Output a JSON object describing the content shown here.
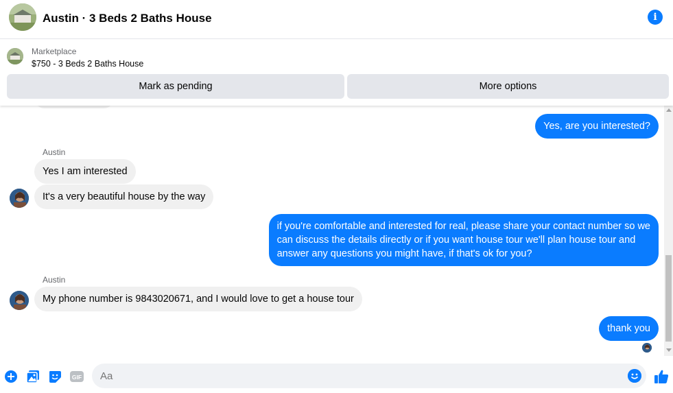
{
  "header": {
    "title": "Austin · 3 Beds 2 Baths House",
    "info_icon": "info-icon"
  },
  "listing": {
    "source": "Marketplace",
    "price_title": "$750 - 3 Beds 2 Baths House",
    "mark_pending_label": "Mark as pending",
    "more_options_label": "More options"
  },
  "messages": [
    {
      "from": "me",
      "text": "Yes, are you interested?"
    },
    {
      "from": "Austin",
      "sender_label": "Austin",
      "text": "Yes I am interested"
    },
    {
      "from": "Austin",
      "text": "It's a very beautiful house by the way"
    },
    {
      "from": "me",
      "lines": [
        "if you're comfortable and interested for real, please share your contact number so we",
        "can discuss the details directly or if you want house tour we'll plan house tour and",
        "answer any questions you might have, if that's ok for you?"
      ]
    },
    {
      "from": "Austin",
      "sender_label": "Austin",
      "text": "My phone number is 9843020671, and I would love to get a house tour"
    },
    {
      "from": "me",
      "text": "thank you"
    }
  ],
  "composer": {
    "placeholder": "Aa",
    "icons": [
      "plus-icon",
      "photo-icon",
      "sticker-icon",
      "gif-icon",
      "emoji-icon",
      "like-icon"
    ],
    "gif_label": "GIF"
  },
  "colors": {
    "accent": "#0a7cff",
    "incoming_bubble": "#f0f0f0",
    "button_bg": "#e4e6eb"
  }
}
